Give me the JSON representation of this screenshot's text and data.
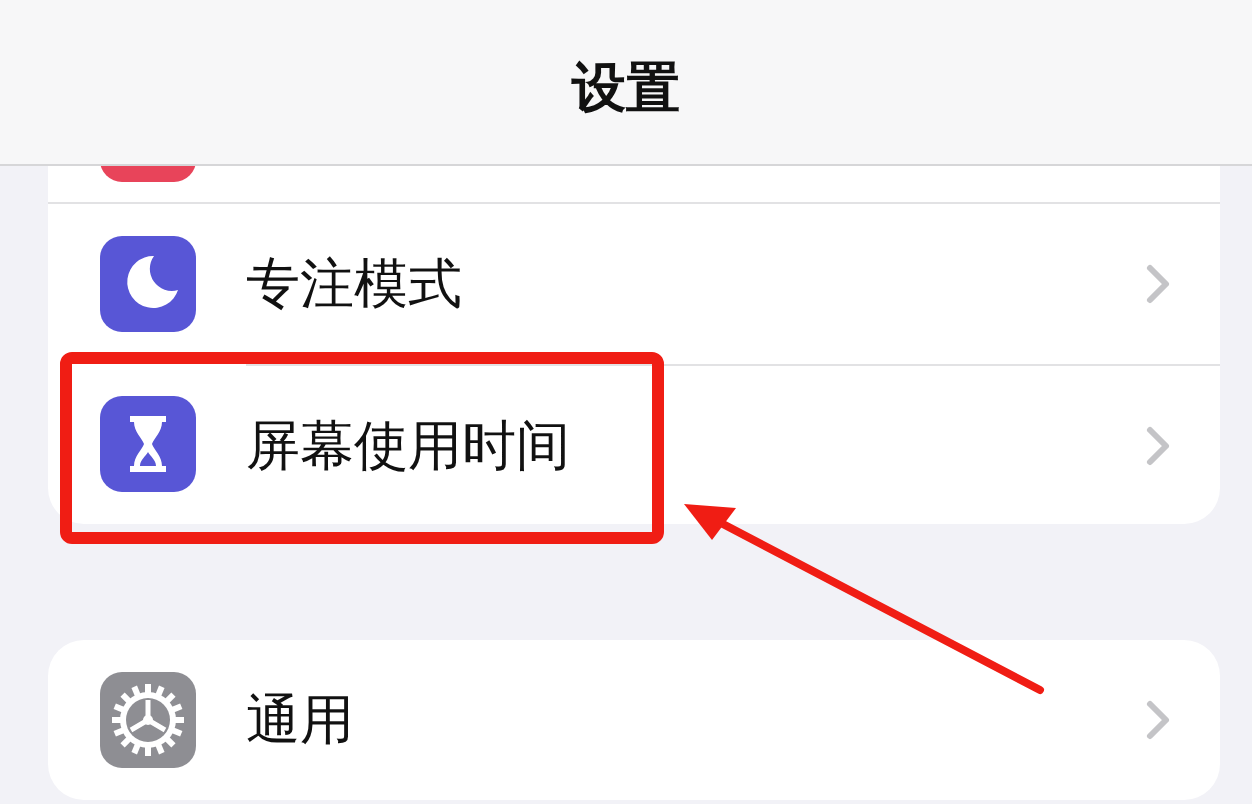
{
  "nav_bar": {
    "title": "设置"
  },
  "sections": [
    {
      "rows": [
        {
          "kind": "moon",
          "label": "专注模式",
          "highlighted": false
        },
        {
          "kind": "hourglass",
          "label": "屏幕使用时间",
          "highlighted": true
        }
      ]
    },
    {
      "rows": [
        {
          "kind": "gear",
          "label": "通用",
          "highlighted": false
        }
      ]
    }
  ]
}
